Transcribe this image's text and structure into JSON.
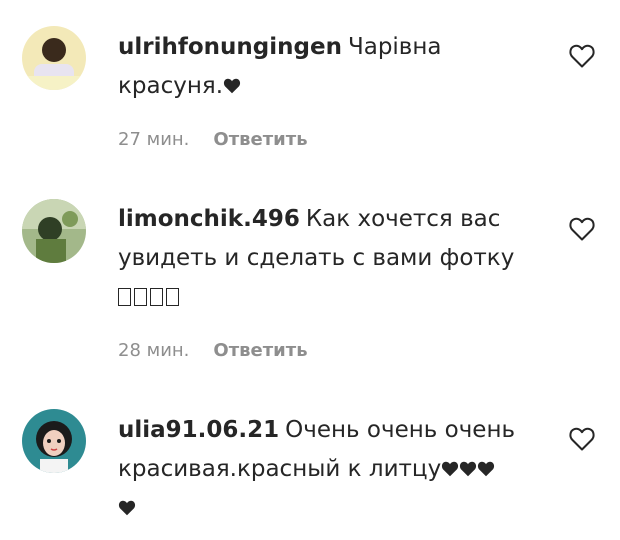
{
  "comments": [
    {
      "username": "ulrihfonungingen",
      "text": "Чарівна красуня.",
      "emoji_hearts": 1,
      "time": "27 мин.",
      "reply_label": "Ответить",
      "avatar_colors": [
        "#f3e9b8",
        "#2a3b5a",
        "#e8d9c8"
      ]
    },
    {
      "username": "limonchik.496",
      "text": "Как хочется вас увидеть и сделать с вами фотку",
      "tofu_glyphs": 4,
      "time": "28 мин.",
      "reply_label": "Ответить",
      "avatar_colors": [
        "#5f7c3e",
        "#a3b88a",
        "#2f3f25"
      ]
    },
    {
      "username": "ulia91.06.21",
      "text": "Очень очень очень красивая.красный к литцу",
      "emoji_hearts": 4,
      "time": "",
      "reply_label": "",
      "avatar_colors": [
        "#2e8b92",
        "#f0d0c0",
        "#1b1b1b"
      ]
    }
  ],
  "icons": {
    "like": "heart-outline-icon",
    "emoji": "black-heart-icon"
  }
}
